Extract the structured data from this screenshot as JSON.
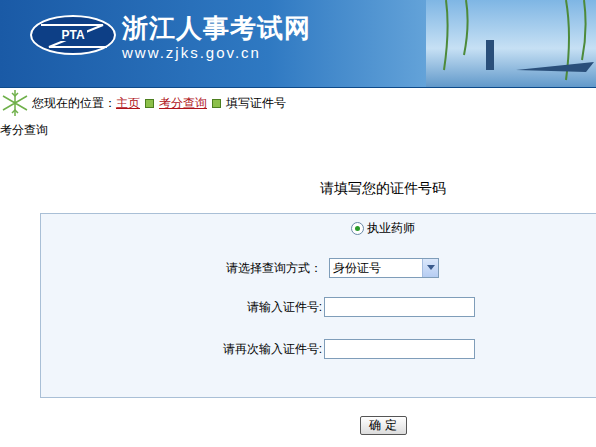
{
  "header": {
    "logo": "PTA",
    "title": "浙江人事考试网",
    "url": "www.zjks.gov.cn"
  },
  "breadcrumb": {
    "prefix": "您现在的位置：",
    "items": [
      {
        "label": "主页",
        "link": true
      },
      {
        "label": "考分查询",
        "link": true
      },
      {
        "label": "填写证件号",
        "link": false
      }
    ]
  },
  "section_title": "考分查询",
  "form": {
    "heading": "请填写您的证件号码",
    "exam_options": [
      {
        "label": "执业药师",
        "selected": true
      }
    ],
    "query_label": "请选择查询方式：",
    "query_value": "身份证号",
    "id_label": "请输入证件号:",
    "id_value": "",
    "confirm_label": "请再次输入证件号:",
    "confirm_value": ""
  },
  "buttons": [
    "确 定"
  ]
}
